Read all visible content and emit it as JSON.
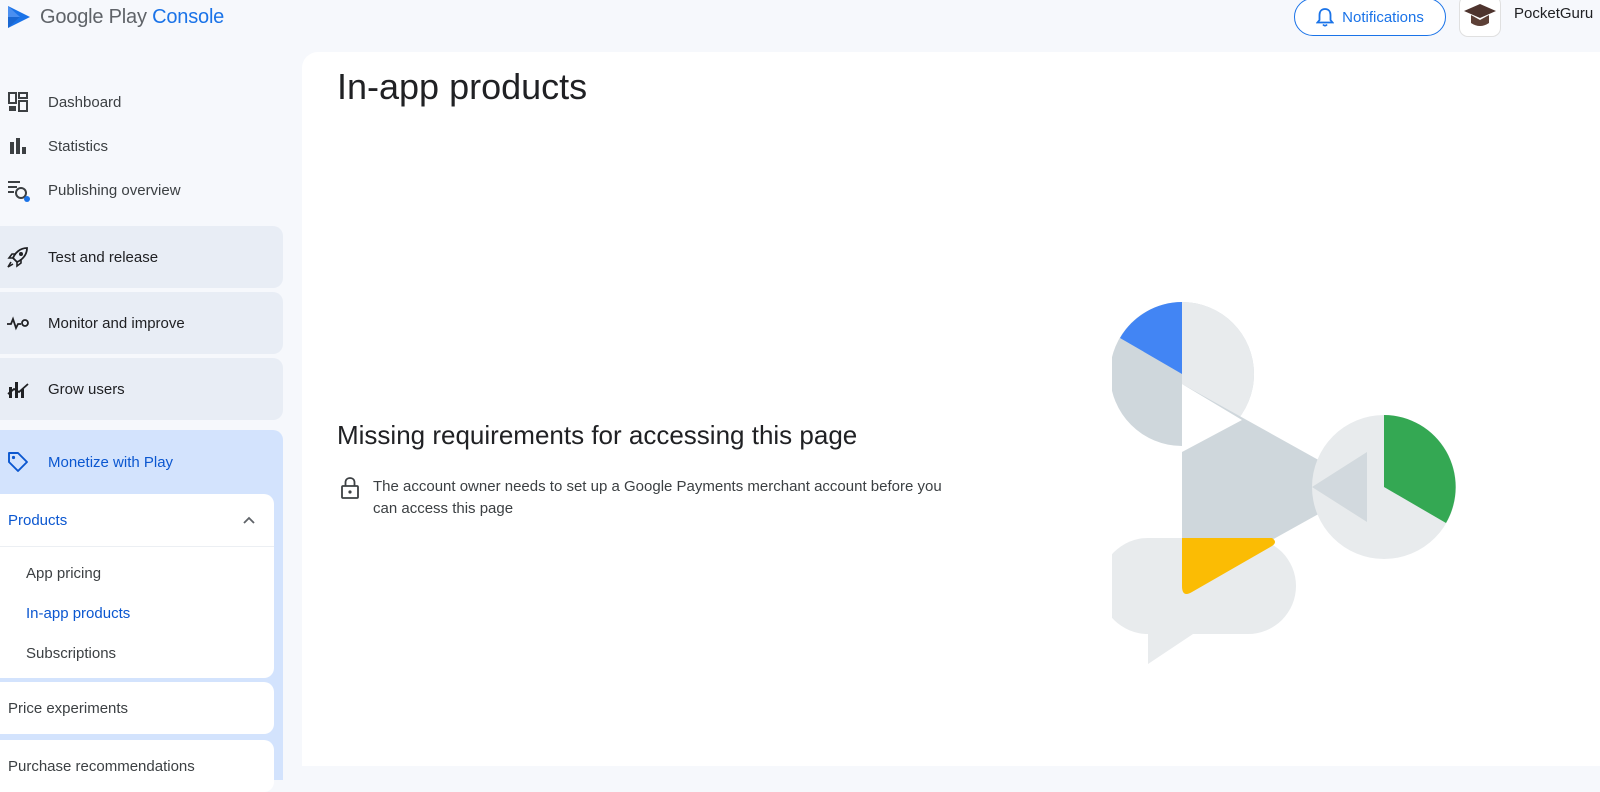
{
  "header": {
    "logo_brand": "Google Play",
    "logo_product": "Console",
    "notifications_label": "Notifications",
    "account_name": "PocketGuru"
  },
  "sidebar": {
    "items": [
      {
        "label": "Dashboard",
        "icon": "dashboard-icon"
      },
      {
        "label": "Statistics",
        "icon": "bar-chart-icon"
      },
      {
        "label": "Publishing overview",
        "icon": "publishing-icon"
      }
    ],
    "sections": [
      {
        "label": "Test and release",
        "icon": "rocket-icon"
      },
      {
        "label": "Monitor and improve",
        "icon": "vitals-icon"
      },
      {
        "label": "Grow users",
        "icon": "grow-chart-icon"
      },
      {
        "label": "Monetize with Play",
        "icon": "tag-icon"
      }
    ],
    "products": {
      "label": "Products",
      "subitems": [
        "App pricing",
        "In-app products",
        "Subscriptions"
      ],
      "selected": "In-app products"
    },
    "price_experiments": "Price experiments",
    "purchase_recommendations": "Purchase recommendations"
  },
  "main": {
    "title": "In-app products",
    "requirement_title": "Missing requirements for accessing this page",
    "requirement_text": "The account owner needs to set up a Google Payments merchant account before you can access this page"
  },
  "colors": {
    "accent": "#0b57d0",
    "blue": "#4285f4",
    "green": "#34a853",
    "yellow": "#fbbc04",
    "gray": "#cfd7dc",
    "light_gray": "#e8ebed"
  }
}
